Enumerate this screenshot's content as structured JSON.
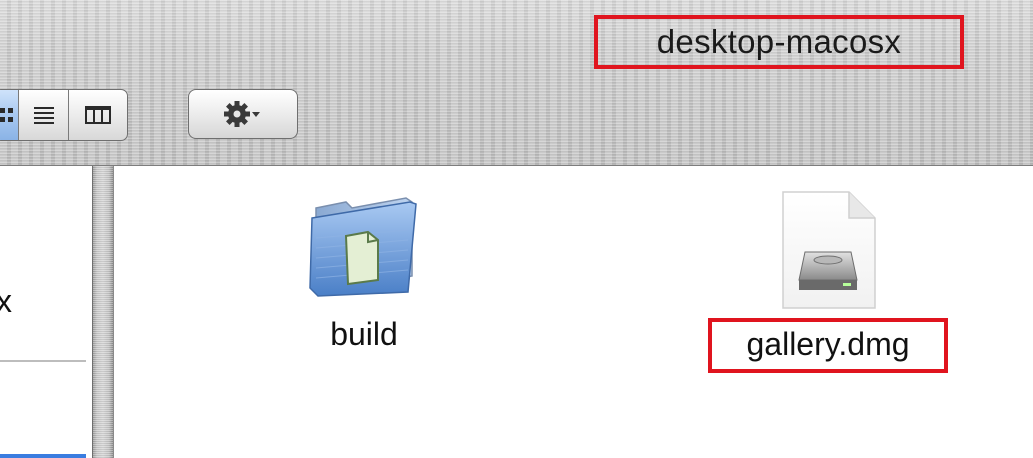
{
  "window": {
    "title": "desktop-macosx"
  },
  "toolbar": {
    "view_buttons": [
      {
        "name": "icon-view",
        "icon": "grid-icon",
        "active": true
      },
      {
        "name": "list-view",
        "icon": "list-icon",
        "active": false
      },
      {
        "name": "column-view",
        "icon": "columns-icon",
        "active": false
      }
    ],
    "action_menu_icon": "gear-icon"
  },
  "sidebar": {
    "partial_item_text": "x"
  },
  "files": [
    {
      "name": "build",
      "kind": "folder",
      "icon": "folder-icon"
    },
    {
      "name": "gallery.dmg",
      "kind": "disk-image",
      "icon": "disk-image-icon"
    }
  ],
  "colors": {
    "highlight": "#e0141e",
    "selection_blue": "#3a7de0",
    "folder_blue": "#5b8fd6"
  }
}
